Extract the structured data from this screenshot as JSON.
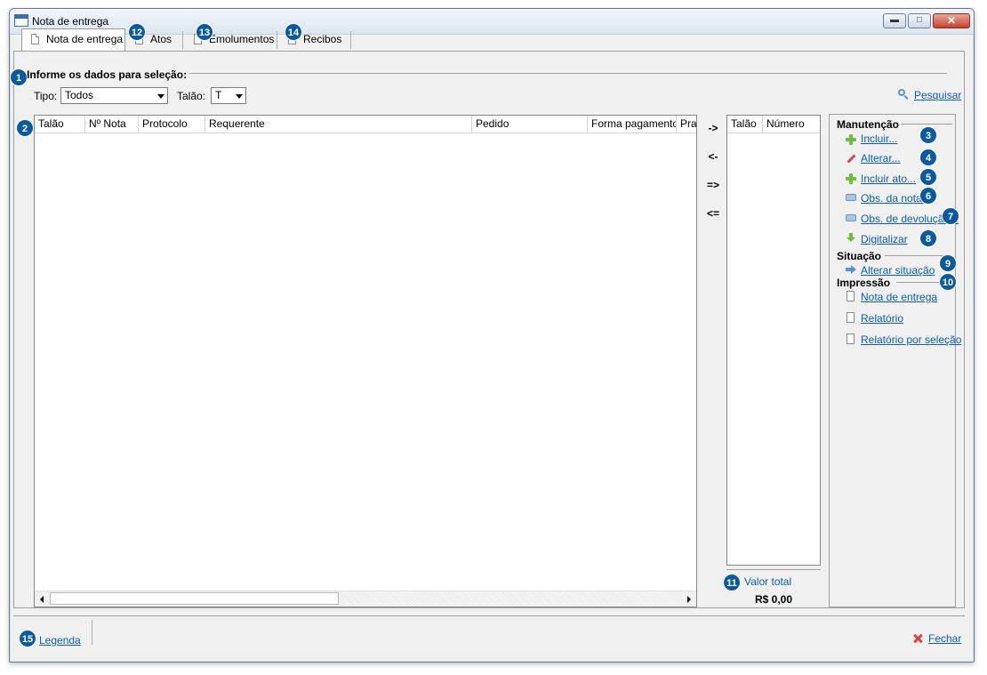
{
  "window": {
    "title": "Nota de entrega"
  },
  "tabs": [
    {
      "label": "Nota de entrega"
    },
    {
      "label": "Atos"
    },
    {
      "label": "Emolumentos"
    },
    {
      "label": "Recibos"
    }
  ],
  "selection": {
    "title": "Informe os dados para seleção:",
    "tipo_label": "Tipo:",
    "tipo_value": "Todos",
    "talao_label": "Talão:",
    "talao_value": "T",
    "search_label": "Pesquisar"
  },
  "grid": {
    "columns": [
      "Talão",
      "Nº Nota",
      "Protocolo",
      "Requerente",
      "Pedido",
      "Forma pagamento",
      "Praz"
    ]
  },
  "move_buttons": [
    "->",
    "<-",
    "=>",
    "<="
  ],
  "selected_list": {
    "columns": [
      "Talão",
      "Número"
    ]
  },
  "total": {
    "label": "Valor total",
    "value": "R$ 0,00"
  },
  "side": {
    "maintenance_title": "Manutenção",
    "maintenance_items": [
      "Incluir...",
      "Alterar...",
      "Incluir ato...",
      "Obs. da nota...",
      "Obs. de devolução...",
      "Digitalizar"
    ],
    "situation_title": "Situação",
    "situation_items": [
      "Alterar situação"
    ],
    "print_title": "Impressão",
    "print_items": [
      "Nota de entrega",
      "Relatório",
      "Relatório por seleção"
    ]
  },
  "footer": {
    "legend_label": "Legenda",
    "close_label": "Fechar"
  },
  "badges": [
    "1",
    "2",
    "3",
    "4",
    "5",
    "6",
    "7",
    "8",
    "9",
    "10",
    "11",
    "12",
    "13",
    "14",
    "15"
  ]
}
